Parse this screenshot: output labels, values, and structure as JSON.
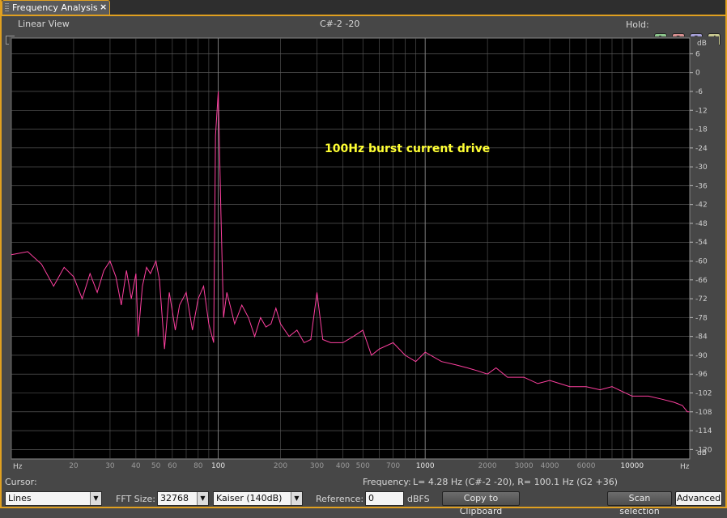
{
  "window": {
    "tab_title": "Frequency Analysis",
    "close_glyph": "×"
  },
  "toolbar": {
    "linear_view_label": "Linear View",
    "linear_view_checked": false,
    "note_readout": "C#-2 -20",
    "hold_label": "Hold:",
    "hold_buttons": [
      {
        "label": "1",
        "color": "#8cc68c"
      },
      {
        "label": "2",
        "color": "#d89090"
      },
      {
        "label": "3",
        "color": "#a6a0d8"
      },
      {
        "label": "4",
        "color": "#c8c890"
      }
    ]
  },
  "plot": {
    "annotation": "100Hz burst current drive",
    "annotation_color": "#ffff33",
    "trace_color": "#ff40a0",
    "y_unit_top": "dB",
    "y_unit_bottom": "dB",
    "x_unit_left": "Hz",
    "x_unit_right": "Hz",
    "y_ticks": [
      "6",
      "0",
      "-6",
      "-12",
      "-18",
      "-24",
      "-30",
      "-36",
      "-42",
      "-48",
      "-54",
      "-60",
      "-66",
      "-72",
      "-78",
      "-84",
      "-90",
      "-96",
      "-102",
      "-108",
      "-114",
      "-120"
    ],
    "x_ticks": [
      {
        "label": "20",
        "value": 20,
        "major": false
      },
      {
        "label": "30",
        "value": 30,
        "major": false
      },
      {
        "label": "40",
        "value": 40,
        "major": false
      },
      {
        "label": "50",
        "value": 50,
        "major": false
      },
      {
        "label": "60",
        "value": 60,
        "major": false
      },
      {
        "label": "80",
        "value": 80,
        "major": false
      },
      {
        "label": "100",
        "value": 100,
        "major": true
      },
      {
        "label": "200",
        "value": 200,
        "major": false
      },
      {
        "label": "300",
        "value": 300,
        "major": false
      },
      {
        "label": "400",
        "value": 400,
        "major": false
      },
      {
        "label": "500",
        "value": 500,
        "major": false
      },
      {
        "label": "700",
        "value": 700,
        "major": false
      },
      {
        "label": "1000",
        "value": 1000,
        "major": true
      },
      {
        "label": "2000",
        "value": 2000,
        "major": false
      },
      {
        "label": "3000",
        "value": 3000,
        "major": false
      },
      {
        "label": "4000",
        "value": 4000,
        "major": false
      },
      {
        "label": "6000",
        "value": 6000,
        "major": false
      },
      {
        "label": "10000",
        "value": 10000,
        "major": true
      }
    ]
  },
  "chart_data": {
    "type": "line",
    "x_scale": "log",
    "xlim": [
      10,
      19000
    ],
    "ylim": [
      -123,
      11
    ],
    "grid": true,
    "series": [
      {
        "x": [
          10,
          12,
          14,
          16,
          18,
          20,
          22,
          24,
          26,
          28,
          30,
          32,
          34,
          36,
          38,
          40,
          41,
          43,
          45,
          47,
          50,
          52,
          55,
          58,
          60,
          62,
          65,
          70,
          75,
          80,
          85,
          90,
          95,
          97,
          100,
          103,
          106,
          110,
          115,
          120,
          130,
          140,
          150,
          160,
          170,
          180,
          190,
          200,
          220,
          240,
          260,
          280,
          300,
          320,
          350,
          400,
          450,
          500,
          550,
          600,
          700,
          800,
          900,
          1000,
          1200,
          1400,
          1600,
          1800,
          2000,
          2200,
          2500,
          3000,
          3500,
          4000,
          5000,
          6000,
          7000,
          8000,
          10000,
          12000,
          14000,
          16000,
          17500,
          18500,
          18900
        ],
        "y": [
          -58,
          -57,
          -61,
          -68,
          -62,
          -65,
          -72,
          -64,
          -70,
          -63,
          -60,
          -65,
          -74,
          -63,
          -72,
          -64,
          -84,
          -68,
          -62,
          -64,
          -60,
          -66,
          -88,
          -70,
          -76,
          -82,
          -74,
          -70,
          -82,
          -72,
          -68,
          -80,
          -86,
          -20,
          -6,
          -45,
          -78,
          -70,
          -75,
          -80,
          -74,
          -78,
          -84,
          -78,
          -81,
          -80,
          -75,
          -80,
          -84,
          -82,
          -86,
          -85,
          -70,
          -85,
          -86,
          -86,
          -84,
          -82,
          -90,
          -88,
          -86,
          -90,
          -92,
          -89,
          -92,
          -93,
          -94,
          -95,
          -96,
          -94,
          -97,
          -97,
          -99,
          -98,
          -100,
          -100,
          -101,
          -100,
          -103,
          -103,
          -104,
          -105,
          -106,
          -108,
          -108
        ]
      }
    ]
  },
  "footer": {
    "cursor_label": "Cursor:",
    "frequency_label": "Frequency:",
    "frequency_readout": "L=   4.28 Hz (C#-2 -20), R=  100.1 Hz (G2 +36)",
    "display_mode": "Lines",
    "fft_size_label": "FFT Size:",
    "fft_size": "32768",
    "window_function": "Kaiser (140dB)",
    "reference_label": "Reference:",
    "reference_value": "0",
    "reference_unit": "dBFS",
    "copy_button": "Copy to Clipboard",
    "scan_button": "Scan selection",
    "advanced_button": "Advanced"
  }
}
